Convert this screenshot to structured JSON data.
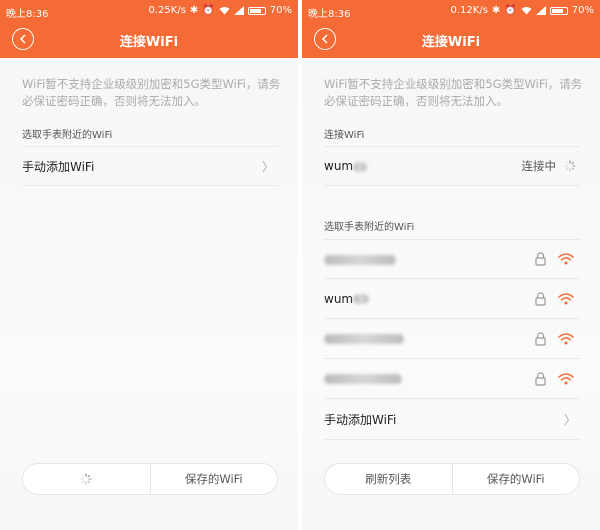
{
  "status_bar": {
    "left_screen": {
      "time": "晚上8:36",
      "speed": "0.25K/s",
      "battery": "70%"
    },
    "right_screen": {
      "time": "晚上8:36",
      "speed": "0.12K/s",
      "battery": "70%"
    }
  },
  "title": "连接WiFi",
  "notice": "WiFi暂不支持企业级级别加密和5G类型WiFi，请务必保证密码正确，否则将无法加入。",
  "left_screen": {
    "section_nearby": "选取手表附近的WiFi",
    "manual_add": "手动添加WiFi",
    "bottom": {
      "saved": "保存的WiFi"
    }
  },
  "right_screen": {
    "section_connected": "连接WiFi",
    "connected_network": {
      "name": "wum",
      "status": "连接中"
    },
    "section_nearby": "选取手表附近的WiFi",
    "networks": [
      {
        "name": "",
        "locked": true
      },
      {
        "name": "wum",
        "locked": true
      },
      {
        "name": "",
        "locked": true
      },
      {
        "name": "",
        "locked": true
      }
    ],
    "manual_add": "手动添加WiFi",
    "bottom": {
      "refresh": "刷新列表",
      "saved": "保存的WiFi"
    }
  },
  "colors": {
    "accent": "#f56b35",
    "wifi": "#f56b35",
    "background": "#f7f7f7"
  },
  "icons": [
    "back-icon",
    "bluetooth-icon",
    "alarm-icon",
    "wifi-icon",
    "signal-icon",
    "battery-icon",
    "lock-icon",
    "wifi-signal-icon",
    "spinner-icon",
    "chevron-right-icon"
  ]
}
